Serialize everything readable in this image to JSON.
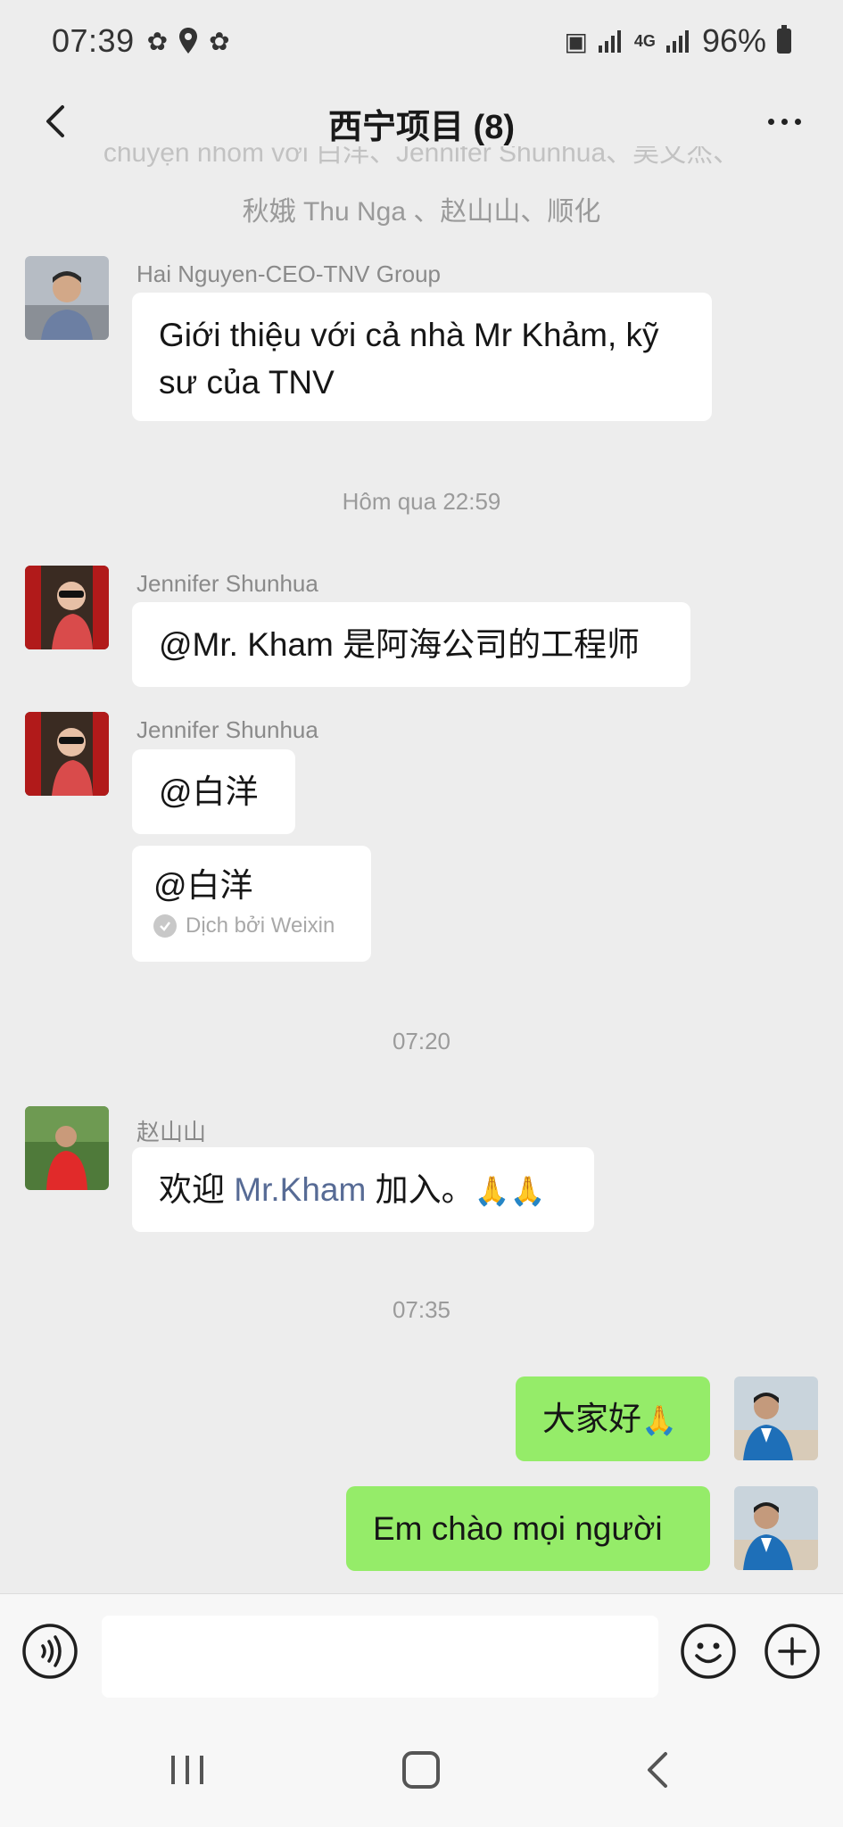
{
  "status_bar": {
    "time": "07:39",
    "network": "4G",
    "battery": "96%"
  },
  "header": {
    "title": "西宁项目 (8)"
  },
  "system": {
    "faded_line": "chuyện nhóm với 白洋、Jennifer Shunhua、吴文杰、",
    "members_line": "秋娥 Thu Nga 、赵山山、顺化"
  },
  "messages": {
    "m1": {
      "sender": "Hai Nguyen-CEO-TNV Group",
      "text_line1": "Giới thiệu với cả nhà Mr Khảm, kỹ",
      "text_line2": "sư của TNV"
    },
    "time1": "Hôm qua 22:59",
    "m2": {
      "sender": "Jennifer Shunhua",
      "text": "@Mr. Kham  是阿海公司的工程师"
    },
    "m3": {
      "sender": "Jennifer Shunhua",
      "text": "@白洋"
    },
    "m4": {
      "text": "@白洋",
      "translated_by": "Dịch bởi Weixin"
    },
    "time2": "07:20",
    "m5": {
      "sender": "赵山山",
      "text_before": "欢迎 ",
      "mention": "Mr.Kham",
      "text_after": " 加入。"
    },
    "time3": "07:35",
    "m6": {
      "text": "大家好"
    },
    "m7": {
      "text": "Em chào mọi người"
    }
  },
  "colors": {
    "background": "#ededed",
    "bubble_other": "#ffffff",
    "bubble_me": "#95ec69",
    "mention": "#576b95"
  }
}
